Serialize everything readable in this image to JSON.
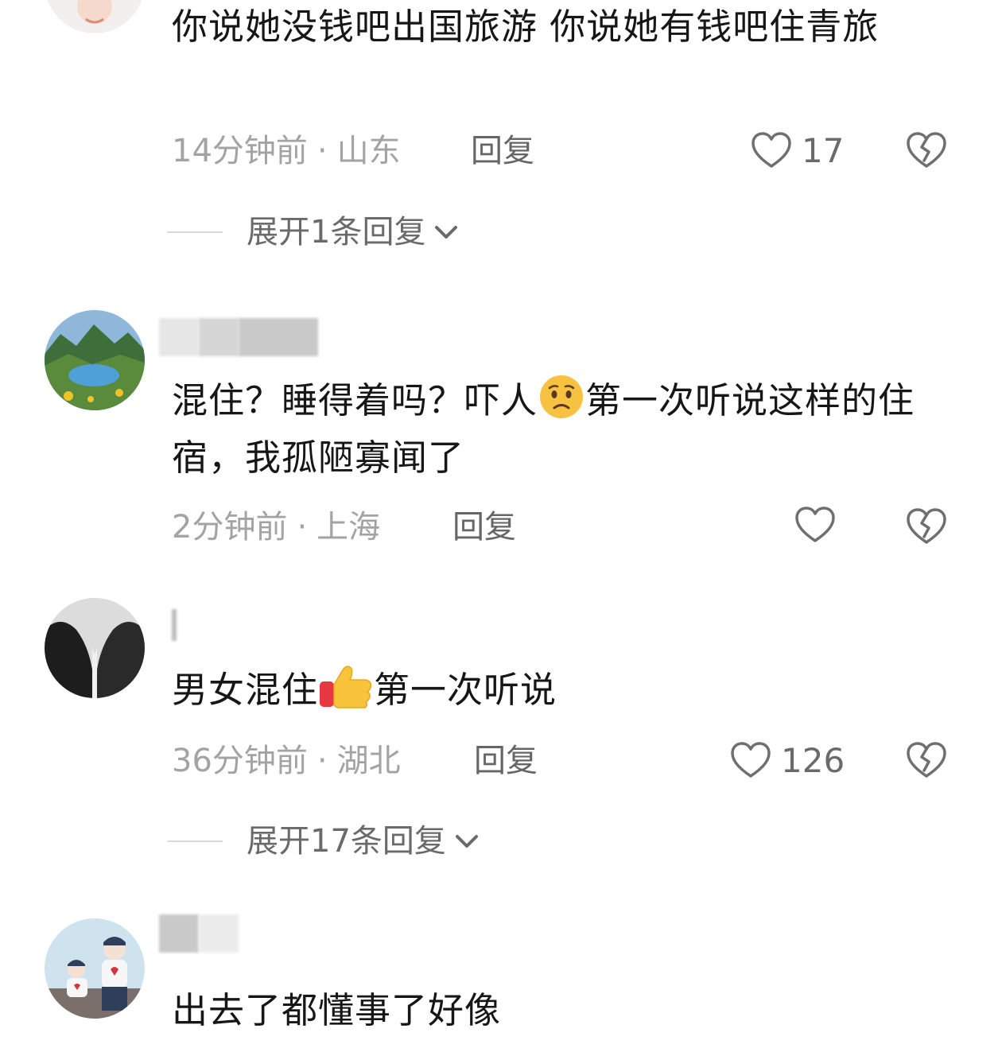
{
  "comments": [
    {
      "text": "你说她没钱吧出国旅游 你说她有钱吧住青旅",
      "time": "14分钟前",
      "location": "山东",
      "reply_label": "回复",
      "likes": "17",
      "expand_label": "展开1条回复"
    },
    {
      "text_a": "混住？睡得着吗？吓人",
      "emoji": "worried-face",
      "text_b": "第一次听说这样的住宿，我孤陋寡闻了",
      "time": "2分钟前",
      "location": "上海",
      "reply_label": "回复"
    },
    {
      "text_a": "男女混住",
      "emoji": "thumbs-up",
      "text_b": "第一次听说",
      "time": "36分钟前",
      "location": "湖北",
      "reply_label": "回复",
      "likes": "126",
      "expand_label": "展开17条回复"
    },
    {
      "text": "出去了都懂事了好像"
    }
  ],
  "separator": "·",
  "colors": {
    "text": "#161616",
    "meta": "#a3a3a3",
    "action": "#666666",
    "icon_stroke": "#6f6f6f"
  },
  "icons": [
    "heart-outline-icon",
    "broken-heart-icon",
    "chevron-down-icon"
  ]
}
